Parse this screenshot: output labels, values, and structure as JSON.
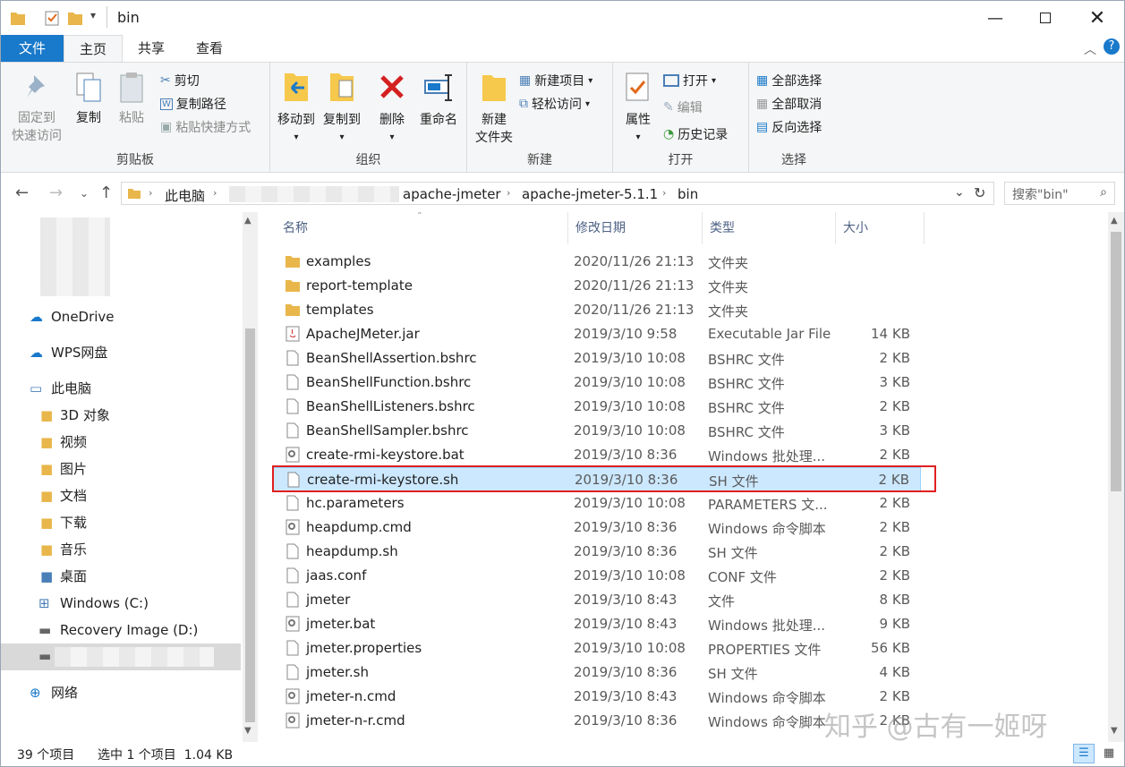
{
  "window": {
    "title": "bin"
  },
  "ribbon_tabs": [
    "文件",
    "主页",
    "共享",
    "查看"
  ],
  "ribbon": {
    "clipboard": {
      "label": "剪贴板",
      "pin": "固定到\n快速访问",
      "copy": "复制",
      "paste": "粘贴",
      "cut": "剪切",
      "copy_path": "复制路径",
      "paste_shortcut": "粘贴快捷方式"
    },
    "organize": {
      "label": "组织",
      "move_to": "移动到",
      "copy_to": "复制到",
      "delete": "删除",
      "rename": "重命名"
    },
    "new": {
      "label": "新建",
      "new_folder": "新建\n文件夹",
      "new_item": "新建项目",
      "easy_access": "轻松访问"
    },
    "open": {
      "label": "打开",
      "properties": "属性",
      "open": "打开",
      "edit": "编辑",
      "history": "历史记录"
    },
    "select": {
      "label": "选择",
      "select_all": "全部选择",
      "select_none": "全部取消",
      "invert": "反向选择"
    }
  },
  "address": {
    "crumbs": [
      "此电脑",
      "apache-jmeter",
      "apache-jmeter-5.1.1",
      "bin"
    ],
    "search_placeholder": "搜索\"bin\""
  },
  "nav": [
    {
      "label": "OneDrive",
      "icon": "cloud-icon"
    },
    {
      "label": "WPS网盘",
      "icon": "cloud-icon"
    },
    {
      "label": "此电脑",
      "icon": "computer-icon"
    },
    {
      "label": "3D 对象",
      "icon": "folder-3d-icon"
    },
    {
      "label": "视频",
      "icon": "video-folder-icon"
    },
    {
      "label": "图片",
      "icon": "picture-folder-icon"
    },
    {
      "label": "文档",
      "icon": "document-folder-icon"
    },
    {
      "label": "下载",
      "icon": "download-folder-icon"
    },
    {
      "label": "音乐",
      "icon": "music-folder-icon"
    },
    {
      "label": "桌面",
      "icon": "desktop-folder-icon"
    },
    {
      "label": "Windows (C:)",
      "icon": "drive-icon"
    },
    {
      "label": "Recovery Image (D:)",
      "icon": "drive-icon"
    },
    {
      "label": "",
      "icon": "drive-icon"
    },
    {
      "label": "网络",
      "icon": "network-icon"
    }
  ],
  "columns": {
    "name": "名称",
    "date": "修改日期",
    "type": "类型",
    "size": "大小"
  },
  "files": [
    {
      "name": "examples",
      "date": "2020/11/26 21:13",
      "type": "文件夹",
      "size": "",
      "icon": "folder"
    },
    {
      "name": "report-template",
      "date": "2020/11/26 21:13",
      "type": "文件夹",
      "size": "",
      "icon": "folder"
    },
    {
      "name": "templates",
      "date": "2020/11/26 21:13",
      "type": "文件夹",
      "size": "",
      "icon": "folder"
    },
    {
      "name": "ApacheJMeter.jar",
      "date": "2019/3/10 9:58",
      "type": "Executable Jar File",
      "size": "14 KB",
      "icon": "jar"
    },
    {
      "name": "BeanShellAssertion.bshrc",
      "date": "2019/3/10 10:08",
      "type": "BSHRC 文件",
      "size": "2 KB",
      "icon": "file"
    },
    {
      "name": "BeanShellFunction.bshrc",
      "date": "2019/3/10 10:08",
      "type": "BSHRC 文件",
      "size": "3 KB",
      "icon": "file"
    },
    {
      "name": "BeanShellListeners.bshrc",
      "date": "2019/3/10 10:08",
      "type": "BSHRC 文件",
      "size": "2 KB",
      "icon": "file"
    },
    {
      "name": "BeanShellSampler.bshrc",
      "date": "2019/3/10 10:08",
      "type": "BSHRC 文件",
      "size": "3 KB",
      "icon": "file"
    },
    {
      "name": "create-rmi-keystore.bat",
      "date": "2019/3/10 8:36",
      "type": "Windows 批处理...",
      "size": "2 KB",
      "icon": "gear"
    },
    {
      "name": "create-rmi-keystore.sh",
      "date": "2019/3/10 8:36",
      "type": "SH 文件",
      "size": "2 KB",
      "icon": "file",
      "selected": true
    },
    {
      "name": "hc.parameters",
      "date": "2019/3/10 10:08",
      "type": "PARAMETERS 文...",
      "size": "2 KB",
      "icon": "file"
    },
    {
      "name": "heapdump.cmd",
      "date": "2019/3/10 8:36",
      "type": "Windows 命令脚本",
      "size": "2 KB",
      "icon": "gear"
    },
    {
      "name": "heapdump.sh",
      "date": "2019/3/10 8:36",
      "type": "SH 文件",
      "size": "2 KB",
      "icon": "file"
    },
    {
      "name": "jaas.conf",
      "date": "2019/3/10 10:08",
      "type": "CONF 文件",
      "size": "2 KB",
      "icon": "file"
    },
    {
      "name": "jmeter",
      "date": "2019/3/10 8:43",
      "type": "文件",
      "size": "8 KB",
      "icon": "file"
    },
    {
      "name": "jmeter.bat",
      "date": "2019/3/10 8:43",
      "type": "Windows 批处理...",
      "size": "9 KB",
      "icon": "gear"
    },
    {
      "name": "jmeter.properties",
      "date": "2019/3/10 10:08",
      "type": "PROPERTIES 文件",
      "size": "56 KB",
      "icon": "file"
    },
    {
      "name": "jmeter.sh",
      "date": "2019/3/10 8:36",
      "type": "SH 文件",
      "size": "4 KB",
      "icon": "file"
    },
    {
      "name": "jmeter-n.cmd",
      "date": "2019/3/10 8:43",
      "type": "Windows 命令脚本",
      "size": "2 KB",
      "icon": "gear"
    },
    {
      "name": "jmeter-n-r.cmd",
      "date": "2019/3/10 8:36",
      "type": "Windows 命令脚本",
      "size": "2 KB",
      "icon": "gear"
    }
  ],
  "status": {
    "count": "39 个项目",
    "selected": "选中 1 个项目  1.04 KB"
  },
  "watermark": "知乎 @古有一姬呀",
  "colors": {
    "accent": "#1979ca",
    "selection": "#cce8ff",
    "highlight_border": "#e02020"
  }
}
